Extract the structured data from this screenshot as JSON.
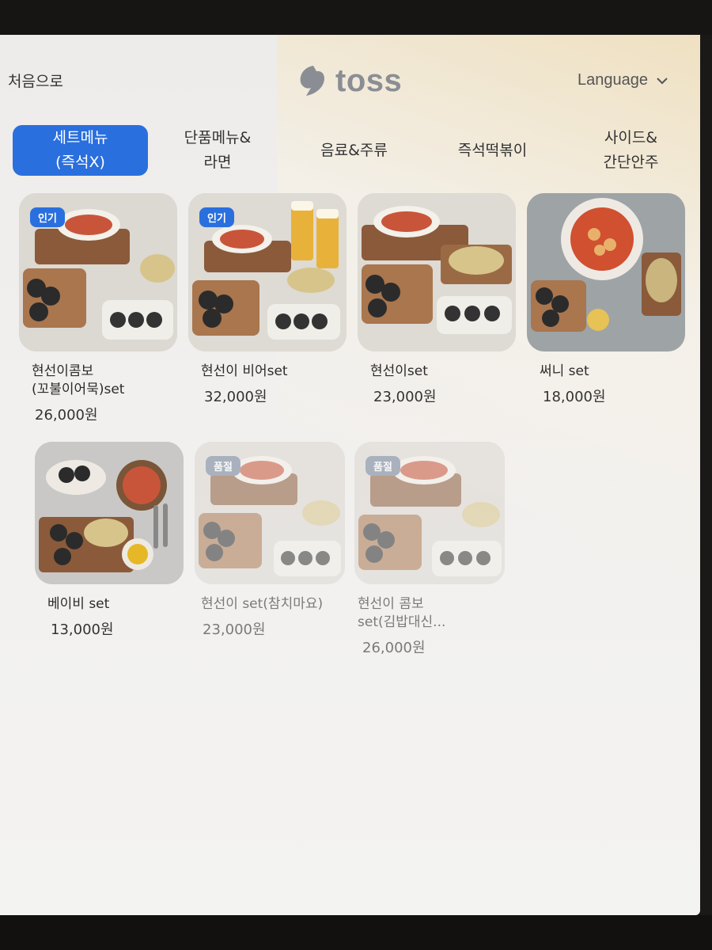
{
  "header": {
    "home_label": "처음으로",
    "brand": "toss",
    "language_label": "Language"
  },
  "tabs": [
    {
      "line1": "세트메뉴",
      "line2": "(즉석X)",
      "active": true
    },
    {
      "line1": "단품메뉴&",
      "line2": "라면",
      "active": false
    },
    {
      "line1": "음료&주류",
      "line2": "",
      "active": false
    },
    {
      "line1": "즉석떡볶이",
      "line2": "",
      "active": false
    },
    {
      "line1": "사이드&",
      "line2": "간단안주",
      "active": false
    }
  ],
  "products": [
    {
      "name": "현선이콤보\n(꼬불이어묵)set",
      "price": "26,000원",
      "badge": "인기",
      "status": "popular"
    },
    {
      "name": "현선이 비어set",
      "price": "32,000원",
      "badge": "인기",
      "status": "popular"
    },
    {
      "name": "현선이set",
      "price": "23,000원",
      "badge": "",
      "status": "available"
    },
    {
      "name": "써니 set",
      "price": "18,000원",
      "badge": "",
      "status": "available"
    },
    {
      "name": "베이비 set",
      "price": "13,000원",
      "badge": "",
      "status": "available"
    },
    {
      "name": "현선이 set(참치마요)",
      "price": "23,000원",
      "badge": "품절",
      "status": "sold-out"
    },
    {
      "name": "현선이 콤보\nset(김밥대신...",
      "price": "26,000원",
      "badge": "품절",
      "status": "sold-out"
    }
  ],
  "colors": {
    "accent": "#2a6fde",
    "sold_badge": "#6f7f99",
    "brand_gray": "#8a8e94"
  }
}
